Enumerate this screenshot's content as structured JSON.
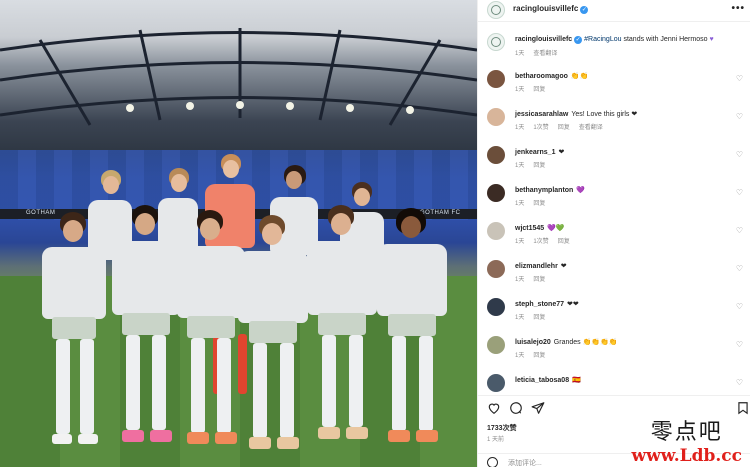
{
  "photo": {
    "stand_text_left": "GOTHAM",
    "stand_text_right": "GOTHAM FC"
  },
  "post": {
    "username": "racinglouisvillefc",
    "caption": {
      "username": "racinglouisvillefc",
      "hashtag": "#RacingLou",
      "text": " stands with Jenni Hermoso ",
      "time": "1天",
      "translate": "查看翻译"
    },
    "comments": [
      {
        "user": "betharoomagoo",
        "text": "👏👏",
        "time": "1天",
        "likes": "",
        "reply": "回复",
        "translate": ""
      },
      {
        "user": "jessicasarahlaw",
        "text": "Yes! Love this girls ❤",
        "time": "1天",
        "likes": "1次赞",
        "reply": "回复",
        "translate": "查看翻译"
      },
      {
        "user": "jenkearns_1",
        "text": "❤",
        "time": "1天",
        "likes": "",
        "reply": "回复",
        "translate": ""
      },
      {
        "user": "bethanymplanton",
        "text": "💜",
        "time": "1天",
        "likes": "",
        "reply": "回复",
        "translate": ""
      },
      {
        "user": "wjct1545",
        "text": "💜💚",
        "time": "1天",
        "likes": "1次赞",
        "reply": "回复",
        "translate": ""
      },
      {
        "user": "elizmandlehr",
        "text": "❤",
        "time": "1天",
        "likes": "",
        "reply": "回复",
        "translate": ""
      },
      {
        "user": "steph_stone77",
        "text": "❤❤",
        "time": "1天",
        "likes": "",
        "reply": "回复",
        "translate": ""
      },
      {
        "user": "luisalejo20",
        "text": "Grandes 👏👏👏👏",
        "time": "1天",
        "likes": "",
        "reply": "回复",
        "translate": ""
      },
      {
        "user": "leticia_tabosa08",
        "text": "🇪🇸",
        "time": "",
        "likes": "",
        "reply": "",
        "translate": ""
      }
    ],
    "likes": "1733次赞",
    "posted": "1 天前",
    "add_comment_placeholder": "添加评论..."
  },
  "watermark": {
    "chinese": "零点吧",
    "url": "www.Ldb.cc"
  },
  "colors": {
    "verified": "#3897f0",
    "link": "#00376b",
    "meta_gray": "#8e8e8e",
    "watermark_red": "#e0201b"
  }
}
